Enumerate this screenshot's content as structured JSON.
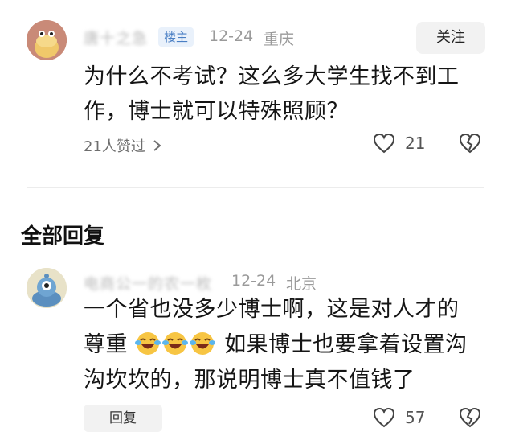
{
  "post": {
    "username": "唐十之急",
    "badge": "楼主",
    "date": "12-24",
    "location": "重庆",
    "follow_label": "关注",
    "text_line1": "为什么不考试？这么多大学生找不到工",
    "text_line2": "作，博士就可以特殊照顾？",
    "likes_text": "21人赞过",
    "like_count": "21"
  },
  "replies_section": {
    "title": "全部回复"
  },
  "reply": {
    "username": "电商公一的农一枚",
    "date": "12-24",
    "location": "北京",
    "text_line1": "一个省也没多少博士啊，这是对人才的",
    "text_line2_prefix": "尊重",
    "text_line2_suffix": "如果博士也要拿着设置沟",
    "text_line3": "沟坎坎的，那说明博士真不值钱了",
    "emoji_icon": "laughing-crying-emoji",
    "reply_label": "回复",
    "like_count": "57"
  },
  "colors": {
    "badge_bg": "#e9f1fb",
    "badge_text": "#4a7fc4",
    "button_bg": "#f2f2f2"
  }
}
